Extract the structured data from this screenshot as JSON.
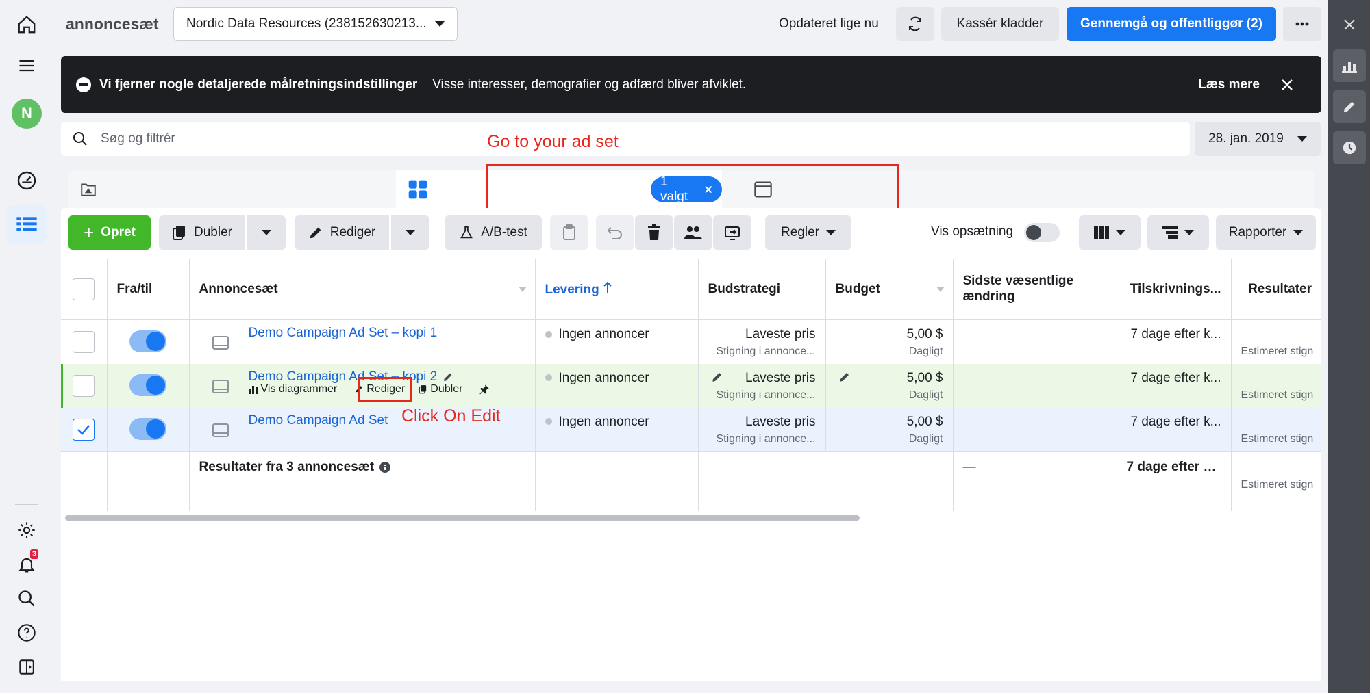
{
  "header": {
    "title": "annoncesæt",
    "account": "Nordic Data Resources (238152630213...",
    "updated": "Opdateret lige nu",
    "discard": "Kassér kladder",
    "review": "Gennemgå og offentliggør (2)"
  },
  "banner": {
    "title": "Vi fjerner nogle detaljerede målretningsindstillinger",
    "body": "Visse interesser, demografier og adfærd bliver afviklet.",
    "link": "Læs mere"
  },
  "search": {
    "placeholder": "Søg og filtrér"
  },
  "date": "28. jan. 2019",
  "annotations": {
    "top": "Go to your ad set",
    "edit": "Click On Edit"
  },
  "selection": {
    "chip": "1 valgt"
  },
  "toolbar": {
    "create": "Opret",
    "duplicate": "Dubler",
    "edit": "Rediger",
    "ab_test": "A/B-test",
    "rules": "Regler",
    "show_setup": "Vis opsætning",
    "reports": "Rapporter"
  },
  "table": {
    "headers": {
      "onoff": "Fra/til",
      "adset": "Annoncesæt",
      "delivery": "Levering",
      "bid": "Budstrategi",
      "budget": "Budget",
      "last_change": "Sidste væsentlige ændring",
      "attribution": "Tilskrivnings...",
      "results": "Resultater"
    },
    "rows": [
      {
        "name": "Demo Campaign Ad Set – kopi 1",
        "delivery": "Ingen annoncer",
        "bid": "Laveste pris",
        "bid_sub": "Stigning i annonce...",
        "budget": "5,00 $",
        "budget_sub": "Dagligt",
        "attribution": "7 dage efter k...",
        "results_sub": "Estimeret stign"
      },
      {
        "name": "Demo Campaign Ad Set – kopi 2",
        "delivery": "Ingen annoncer",
        "bid": "Laveste pris",
        "bid_sub": "Stigning i annonce...",
        "budget": "5,00 $",
        "budget_sub": "Dagligt",
        "attribution": "7 dage efter k...",
        "results_sub": "Estimeret stign",
        "actions": {
          "charts": "Vis diagrammer",
          "edit": "Rediger",
          "duplicate": "Dubler"
        }
      },
      {
        "name": "Demo Campaign Ad Set",
        "delivery": "Ingen annoncer",
        "bid": "Laveste pris",
        "bid_sub": "Stigning i annonce...",
        "budget": "5,00 $",
        "budget_sub": "Dagligt",
        "attribution": "7 dage efter k...",
        "results_sub": "Estimeret stign"
      }
    ],
    "summary": {
      "label": "Resultater fra 3 annoncesæt",
      "last_change": "—",
      "attribution": "7 dage efter kl...",
      "results_sub": "Estimeret stign"
    }
  },
  "nav": {
    "avatar": "N",
    "notifications": "3"
  },
  "colors": {
    "accent": "#1877f2",
    "create": "#42b72a",
    "annotation": "#e8271c"
  }
}
